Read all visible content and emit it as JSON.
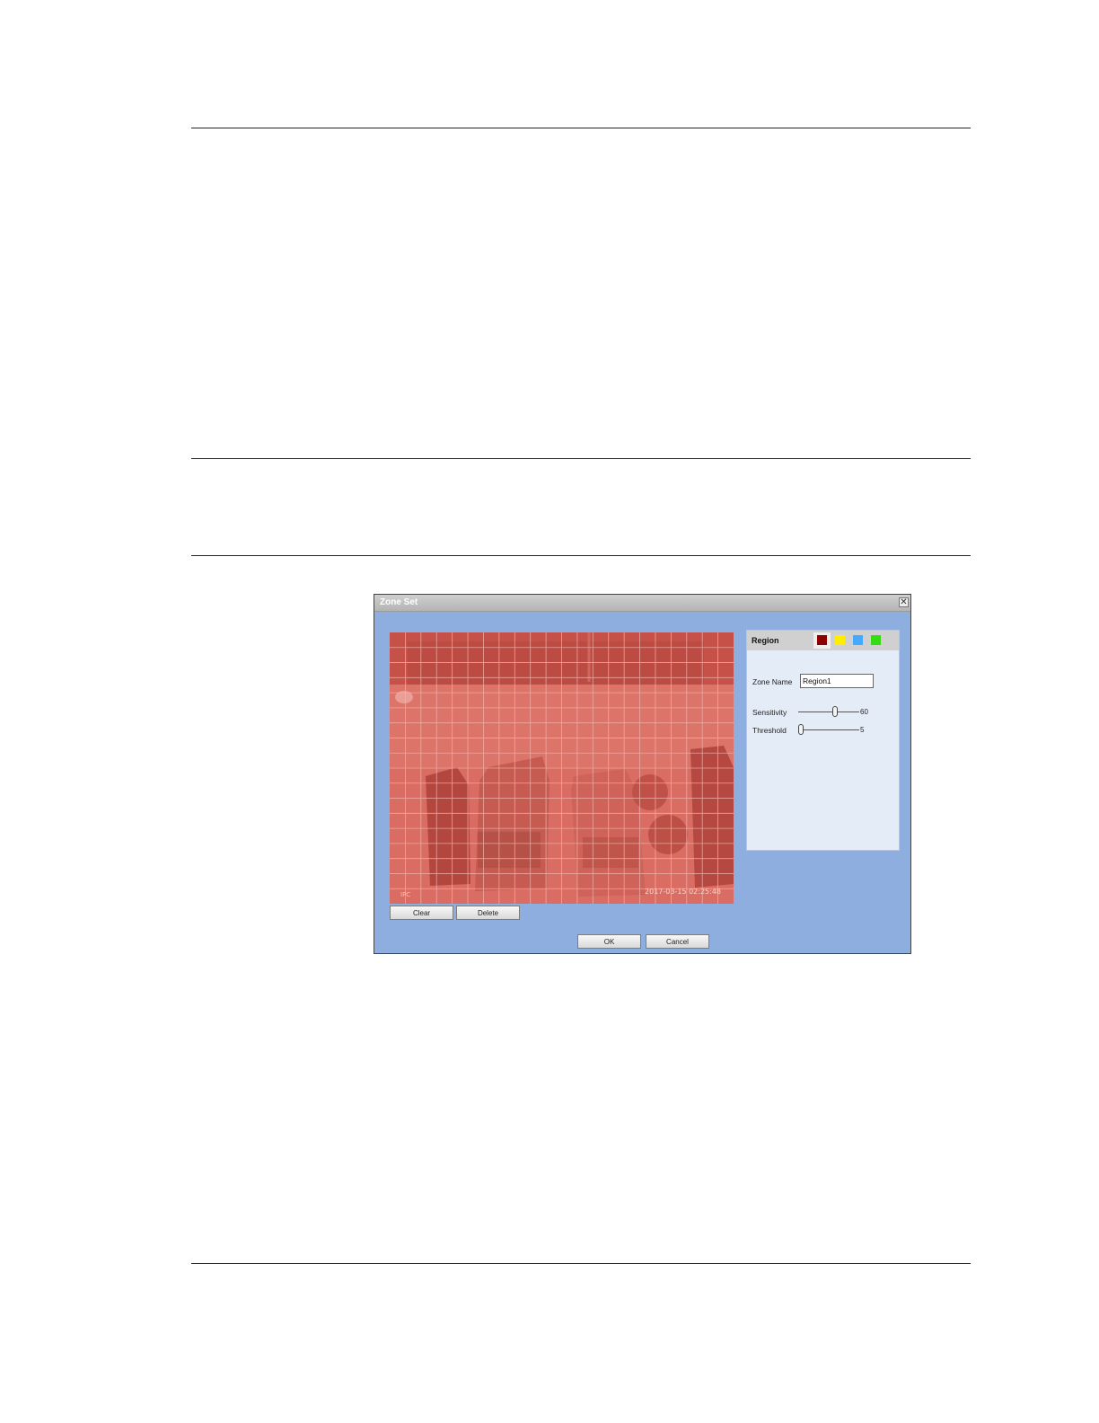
{
  "dialog": {
    "title": "Zone Set",
    "close_glyph": "✕",
    "video": {
      "osd_left": "IPC",
      "osd_timestamp": "2017-03-15 02:25:48",
      "overlay_color": "#e05e52"
    },
    "buttons": {
      "clear": "Clear",
      "delete": "Delete",
      "ok": "OK",
      "cancel": "Cancel"
    },
    "panel": {
      "title": "Region",
      "region_colors": [
        "#8b0000",
        "#ffee00",
        "#44aaff",
        "#33dd11"
      ],
      "active_region": 0,
      "zone_name_label": "Zone Name",
      "zone_name_value": "Region1",
      "sensitivity": {
        "label": "Sensitivity",
        "value": "60",
        "level": 0.6
      },
      "threshold": {
        "label": "Threshold",
        "value": "5",
        "level": 0.05
      }
    }
  }
}
